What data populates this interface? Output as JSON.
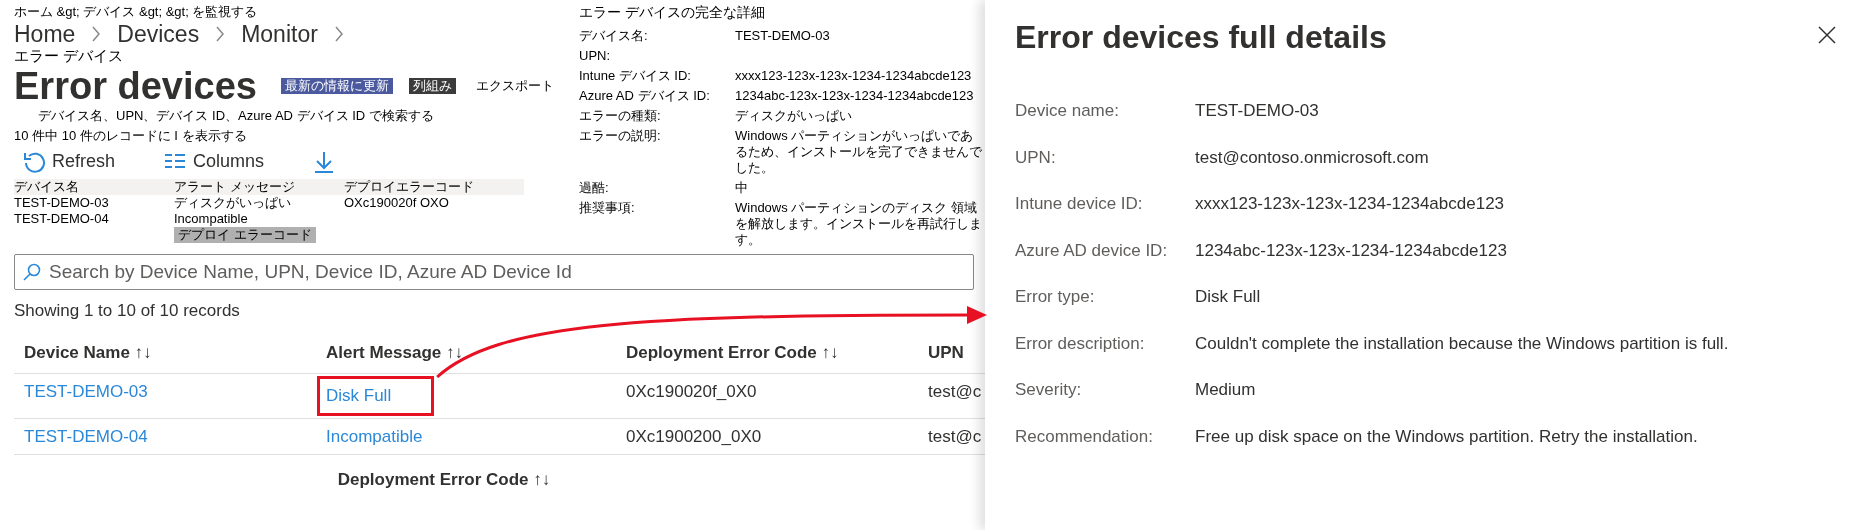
{
  "breadcrumb_ja": "ホーム &gt; デバイス &gt; &gt; を監視する",
  "breadcrumb": [
    {
      "label": "Home"
    },
    {
      "label": "Devices"
    },
    {
      "label": "Monitor"
    }
  ],
  "page_title_ja": "エラー デバイス",
  "page_title": "Error devices",
  "toolbar_ja": [
    {
      "label": "最新の情報に更新",
      "kind": "blue"
    },
    {
      "label": "列組み",
      "kind": "dark"
    },
    {
      "label": "エクスポート",
      "kind": "plain"
    }
  ],
  "search_hint_ja": "デバイス名、UPN、デバイス ID、Azure AD デバイス ID で検索する",
  "count_ja": "10 件中 10 件のレコードに I を表示する",
  "toolbar": [
    {
      "kind": "refresh",
      "label": "Refresh"
    },
    {
      "kind": "columns",
      "label": "Columns"
    },
    {
      "kind": "export"
    }
  ],
  "table_ja": {
    "columns": [
      "デバイス名",
      "アラート メッセージ",
      "デプロイエラーコード"
    ],
    "rows": [
      [
        "TEST-DEMO-03",
        "ディスクがいっぱい",
        "OXc190020f OXO"
      ],
      [
        "TEST-DEMO-04",
        "Incompatible"
      ]
    ],
    "footer": "デプロイ エラーコード"
  },
  "details_ja": {
    "title": "エラー デバイスの完全な詳細",
    "fields": [
      {
        "label": "デバイス名:",
        "value": "TEST-DEMO-03"
      },
      {
        "label": "UPN:"
      },
      {
        "label": "Intune デバイス ID:",
        "value": "xxxx123-123x-123x-1234-1234abcde123"
      },
      {
        "label": "Azure AD デバイス ID:",
        "value": "1234abc-123x-123x-1234-1234abcde123"
      },
      {
        "label": "エラーの種類:",
        "value": "ディスクがいっぱい"
      },
      {
        "label": "エラーの説明:",
        "value": "Windows パーティションがいっぱいであるため、インストールを完了できませんでした。"
      },
      {
        "label": "過酷:",
        "value": "中"
      },
      {
        "label": "推奨事項:",
        "value": "Windows パーティションのディスク 領域を解放します。インストールを再試行します。"
      }
    ]
  },
  "search": {
    "placeholder": "Search by Device Name, UPN, Device ID, Azure AD Device Id"
  },
  "record_count": "Showing 1 to 10 of 10 records",
  "table": {
    "columns": [
      {
        "label": "Device Name",
        "sort": "↑↓"
      },
      {
        "label": "Alert Message",
        "sort": "↑↓"
      },
      {
        "label": "Deployment Error Code",
        "sort": "↑↓"
      },
      {
        "label": "UPN"
      }
    ],
    "rows": [
      {
        "cells": [
          {
            "text": "TEST-DEMO-03",
            "link": true,
            "highlighted": false
          },
          {
            "text": "Disk Full",
            "link": true,
            "highlighted": true
          },
          {
            "text": "0Xc190020f_0X0",
            "link": false,
            "highlighted": false
          },
          {
            "text": "test@c",
            "link": false,
            "highlighted": false
          }
        ]
      },
      {
        "cells": [
          {
            "text": "TEST-DEMO-04",
            "link": true,
            "highlighted": false
          },
          {
            "text": "Incompatible",
            "link": true,
            "highlighted": false
          },
          {
            "text": "0Xc1900200_0X0",
            "link": false,
            "highlighted": false
          },
          {
            "text": "test@c",
            "link": false,
            "highlighted": false
          }
        ]
      }
    ],
    "footer_column": {
      "label": "Deployment Error Code",
      "sort": "↑↓"
    }
  },
  "detail_panel": {
    "title": "Error devices full details",
    "fields": [
      {
        "label": "Device name:",
        "value": "TEST-DEMO-03"
      },
      {
        "label": "UPN:",
        "value": "test@contoso.onmicrosoft.com"
      },
      {
        "label": "Intune device ID:",
        "value": "xxxx123-123x-123x-1234-1234abcde123"
      },
      {
        "label": "Azure AD device ID:",
        "value": "1234abc-123x-123x-1234-1234abcde123"
      },
      {
        "label": "Error type:",
        "value": "Disk Full"
      },
      {
        "label": "Error description:",
        "value": "Couldn't complete the installation because the Windows partition is full."
      },
      {
        "label": "Severity:",
        "value": "Medium"
      },
      {
        "label": "Recommendation:",
        "value": "Free up disk space on the Windows partition. Retry the installation."
      }
    ]
  }
}
